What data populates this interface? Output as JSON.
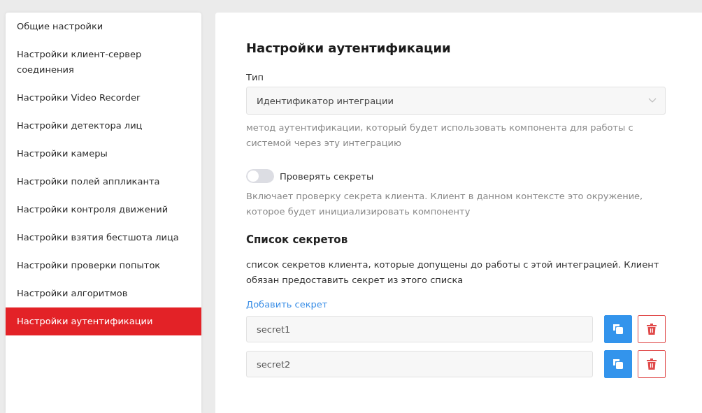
{
  "sidebar": {
    "items": [
      {
        "label": "Общие настройки",
        "selected": false
      },
      {
        "label": "Настройки клиент-сервер соединения",
        "selected": false
      },
      {
        "label": "Настройки Video Recorder",
        "selected": false
      },
      {
        "label": "Настройки детектора лиц",
        "selected": false
      },
      {
        "label": "Настройки камеры",
        "selected": false
      },
      {
        "label": "Настройки полей аппликанта",
        "selected": false
      },
      {
        "label": "Настройки контроля движений",
        "selected": false
      },
      {
        "label": "Настройки взятия бестшота лица",
        "selected": false
      },
      {
        "label": "Настройки проверки попыток",
        "selected": false
      },
      {
        "label": "Настройки алгоритмов",
        "selected": false
      },
      {
        "label": "Настройки аутентификации",
        "selected": true
      }
    ]
  },
  "main": {
    "title": "Настройки аутентификации",
    "type_field": {
      "label": "Тип",
      "value": "Идентификатор интеграции",
      "hint": "метод аутентификации, который будет использовать компонента для работы с системой через эту интеграцию"
    },
    "toggle": {
      "label": "Проверять секреты",
      "on": false,
      "hint": "Включает проверку секрета клиента. Клиент в данном контексте это окружение, которое будет инициализировать компоненту"
    },
    "secrets": {
      "title": "Список секретов",
      "description": "список секретов клиента, которые допущены до работы с этой интеграцией. Клиент обязан предоставить секрет из этого списка",
      "add_link": "Добавить секрет",
      "items": [
        {
          "value": "secret1"
        },
        {
          "value": "secret2"
        }
      ]
    }
  }
}
